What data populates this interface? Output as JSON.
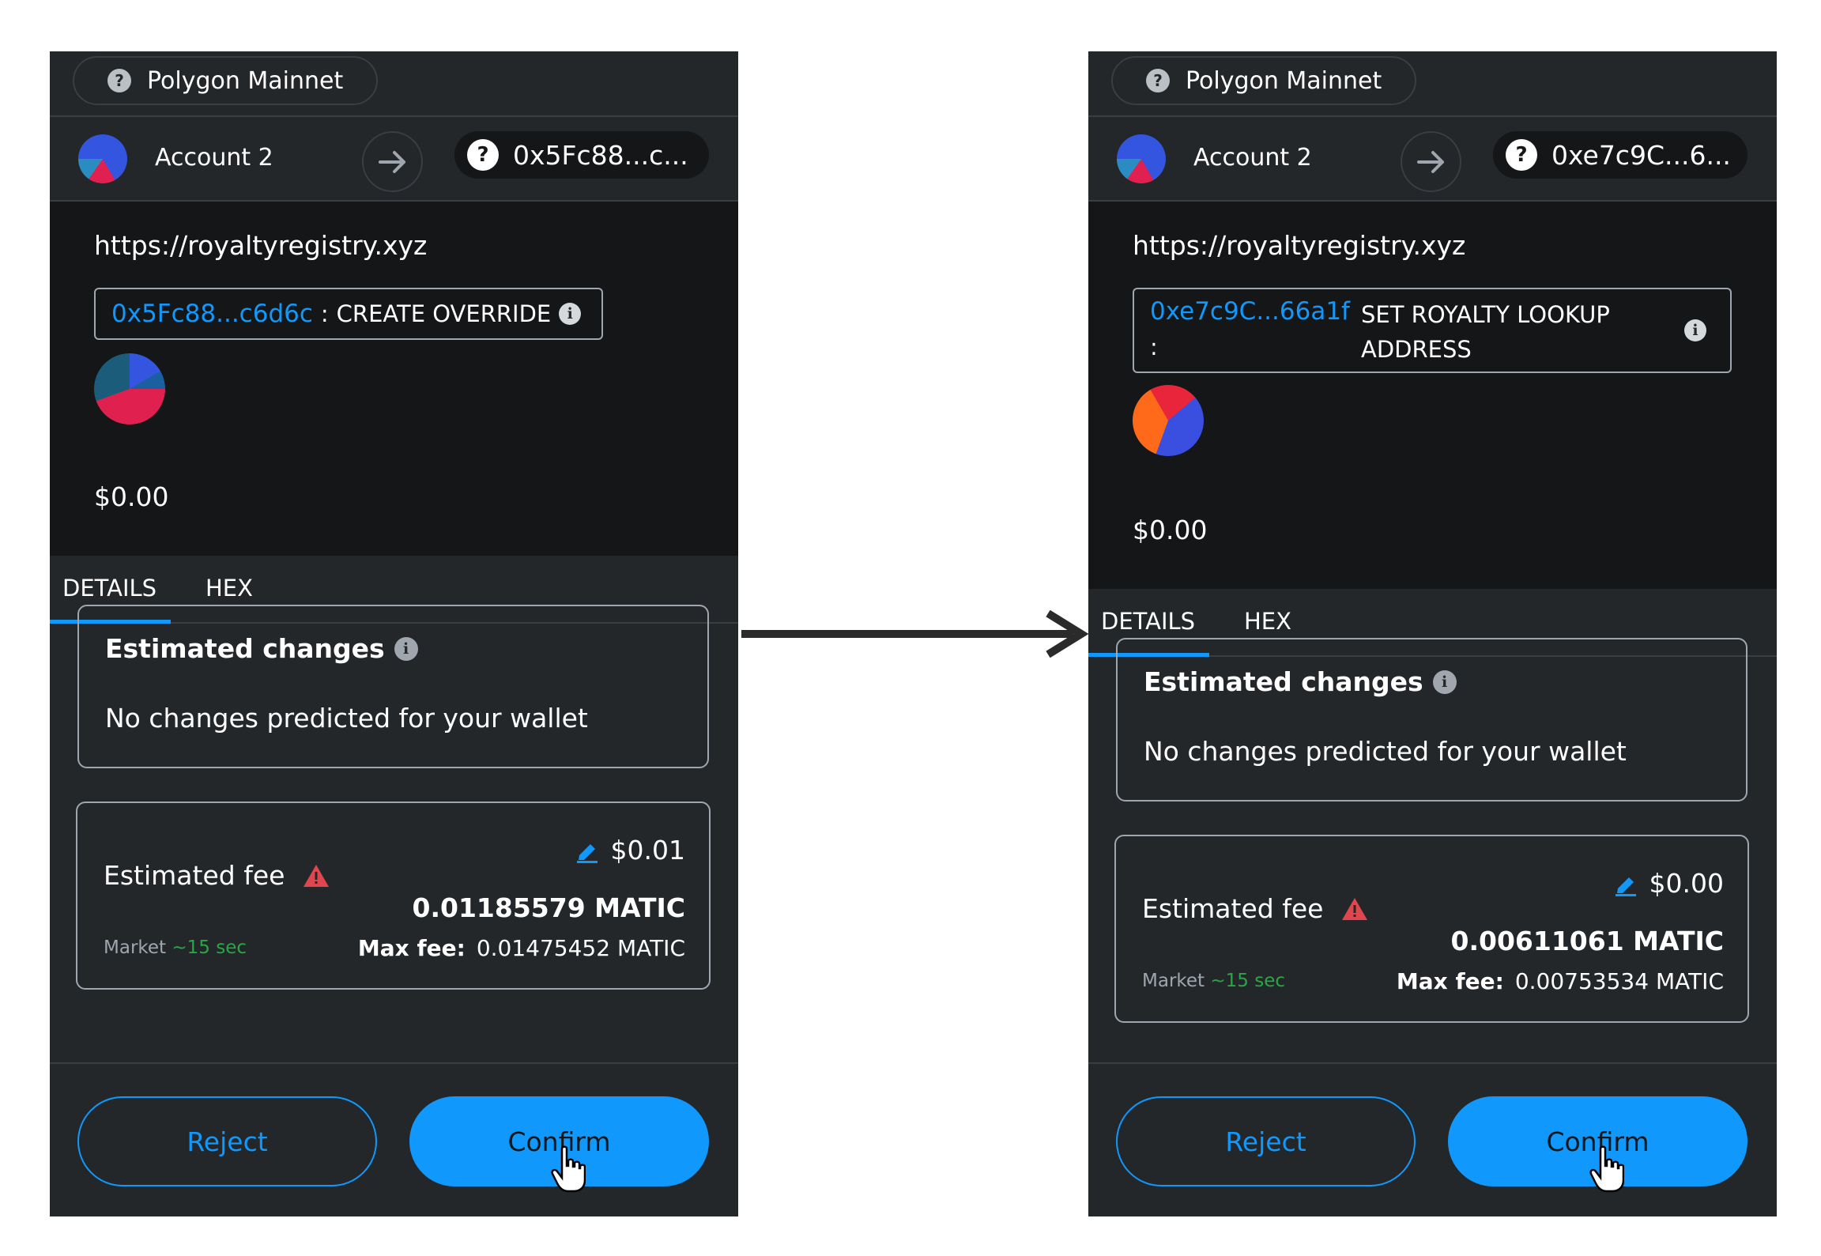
{
  "panels": [
    {
      "network": "Polygon Mainnet",
      "account": "Account 2",
      "recipient": "0x5Fc88...c...",
      "origin": "https://royaltyregistry.xyz",
      "contract_address": "0x5Fc88...c6d6c",
      "contract_separator": ":",
      "contract_method": "CREATE OVERRIDE",
      "amount": "$0.00",
      "tabs": [
        "DETAILS",
        "HEX"
      ],
      "estimated_changes_title": "Estimated changes",
      "estimated_changes_text": "No changes predicted for your wallet",
      "fee_label": "Estimated fee",
      "fee_fiat": "$0.01",
      "fee_crypto": "0.01185579 MATIC",
      "market_label": "Market",
      "market_time": "~15 sec",
      "max_fee_label": "Max fee:",
      "max_fee_value": "0.01475452 MATIC",
      "reject_label": "Reject",
      "confirm_label": "Confirm"
    },
    {
      "network": "Polygon Mainnet",
      "account": "Account 2",
      "recipient": "0xe7c9C...6...",
      "origin": "https://royaltyregistry.xyz",
      "contract_address": "0xe7c9C...66a1f",
      "contract_separator": ":",
      "contract_method": "SET ROYALTY LOOKUP ADDRESS",
      "amount": "$0.00",
      "tabs": [
        "DETAILS",
        "HEX"
      ],
      "estimated_changes_title": "Estimated changes",
      "estimated_changes_text": "No changes predicted for your wallet",
      "fee_label": "Estimated fee",
      "fee_fiat": "$0.00",
      "fee_crypto": "0.00611061 MATIC",
      "market_label": "Market",
      "market_time": "~15 sec",
      "max_fee_label": "Max fee:",
      "max_fee_value": "0.00753534 MATIC",
      "reject_label": "Reject",
      "confirm_label": "Confirm"
    }
  ],
  "colors": {
    "panel_bg": "#24272a",
    "dark_bg": "#141618",
    "accent": "#1098fc",
    "warning": "#e0464e",
    "market_time": "#28a745"
  }
}
